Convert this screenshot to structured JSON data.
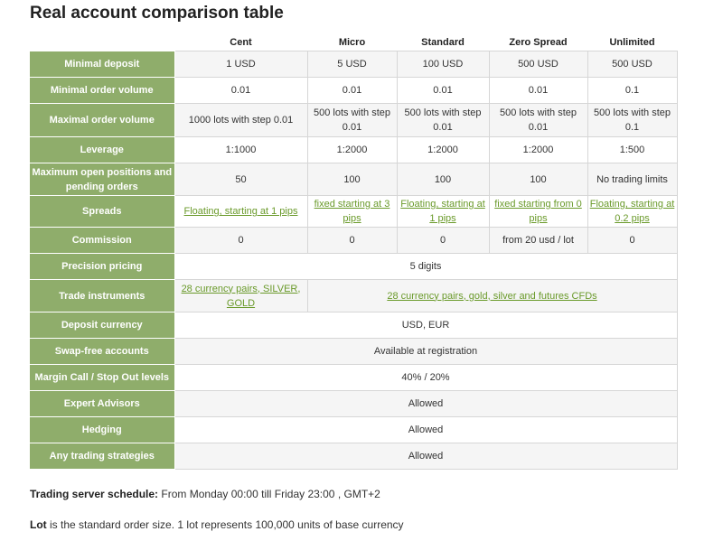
{
  "title": "Real account comparison table",
  "columns": [
    "Cent",
    "Micro",
    "Standard",
    "Zero Spread",
    "Unlimited"
  ],
  "rows": {
    "minimal_deposit": {
      "label": "Minimal deposit",
      "values": [
        "1 USD",
        "5 USD",
        "100 USD",
        "500 USD",
        "500 USD"
      ]
    },
    "minimal_order_volume": {
      "label": "Minimal order volume",
      "values": [
        "0.01",
        "0.01",
        "0.01",
        "0.01",
        "0.1"
      ]
    },
    "maximal_order_volume": {
      "label": "Maximal order volume",
      "values": [
        "1000 lots with step 0.01",
        "500 lots with step 0.01",
        "500 lots with step 0.01",
        "500 lots with step 0.01",
        "500 lots with step 0.1"
      ]
    },
    "leverage": {
      "label": "Leverage",
      "values": [
        "1:1000",
        "1:2000",
        "1:2000",
        "1:2000",
        "1:500"
      ]
    },
    "max_positions": {
      "label": "Maximum open positions and pending orders",
      "values": [
        "50",
        "100",
        "100",
        "100",
        "No trading limits"
      ]
    },
    "spreads": {
      "label": "Spreads",
      "values": [
        "Floating, starting at 1 pips",
        "fixed starting at 3 pips",
        "Floating, starting at 1 pips",
        "fixed starting from 0 pips",
        "Floating, starting at 0.2 pips"
      ]
    },
    "commission": {
      "label": "Commission",
      "values": [
        "0",
        "0",
        "0",
        "from 20 usd / lot",
        "0"
      ]
    },
    "precision_pricing": {
      "label": "Precision pricing",
      "value": "5 digits"
    },
    "trade_instruments": {
      "label": "Trade instruments",
      "cent": "28 currency pairs, SILVER, GOLD",
      "others": "28 currency pairs, gold, silver and futures CFDs"
    },
    "deposit_currency": {
      "label": "Deposit currency",
      "value": "USD, EUR"
    },
    "swap_free": {
      "label": "Swap-free accounts",
      "value": "Available at registration"
    },
    "margin_call": {
      "label": "Margin Call / Stop Out levels",
      "value": "40% / 20%"
    },
    "expert_advisors": {
      "label": "Expert Advisors",
      "value": "Allowed"
    },
    "hedging": {
      "label": "Hedging",
      "value": "Allowed"
    },
    "any_strategies": {
      "label": "Any trading strategies",
      "value": "Allowed"
    }
  },
  "notes": {
    "schedule_label": "Trading server schedule:",
    "schedule_text": " From Monday 00:00  till Friday 23:00 , GMT+2",
    "lot_label": "Lot",
    "lot_text": " is the standard order size. 1 lot represents 100,000 units of base currency"
  },
  "colors": {
    "row_label_bg": "#8fad6b",
    "link": "#6a9a2a",
    "stripe": "#f5f5f5"
  }
}
